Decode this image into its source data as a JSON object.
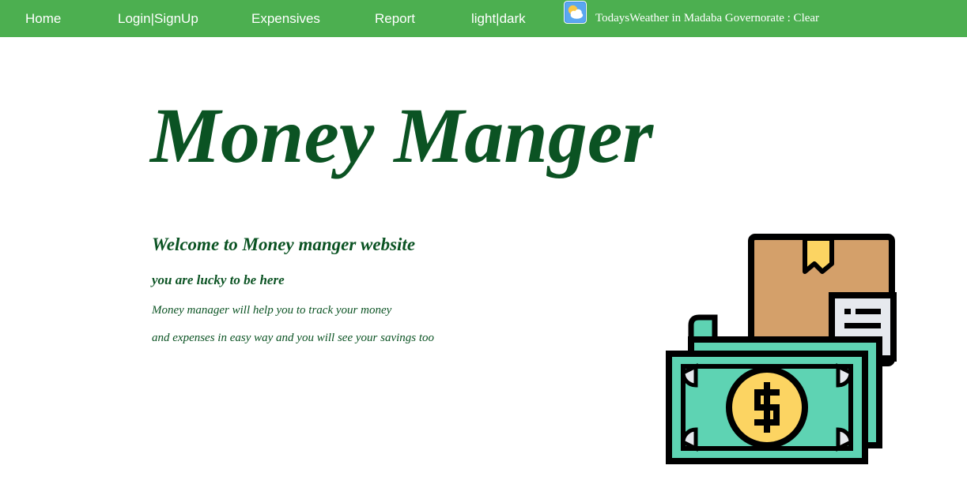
{
  "nav": {
    "home": "Home",
    "login_signup": "Login|SignUp",
    "expensives": "Expensives",
    "report": "Report",
    "theme_toggle": "light|dark"
  },
  "weather": {
    "icon": "partly-cloudy-icon",
    "text": "TodaysWeather in Madaba Governorate : Clear"
  },
  "hero": {
    "title": "Money Manger",
    "welcome": "Welcome to Money manger website",
    "lucky": "you are lucky to be here",
    "desc_line1": "Money manager will help you to track your money",
    "desc_line2": "and expenses in easy way and you will see your savings too"
  },
  "illustration": {
    "icon": "money-box-icon"
  },
  "colors": {
    "navbar": "#4caf50",
    "heading": "#0b5323",
    "bill": "#5ed3b3",
    "box": "#d4a06a",
    "coin": "#fcd462"
  }
}
